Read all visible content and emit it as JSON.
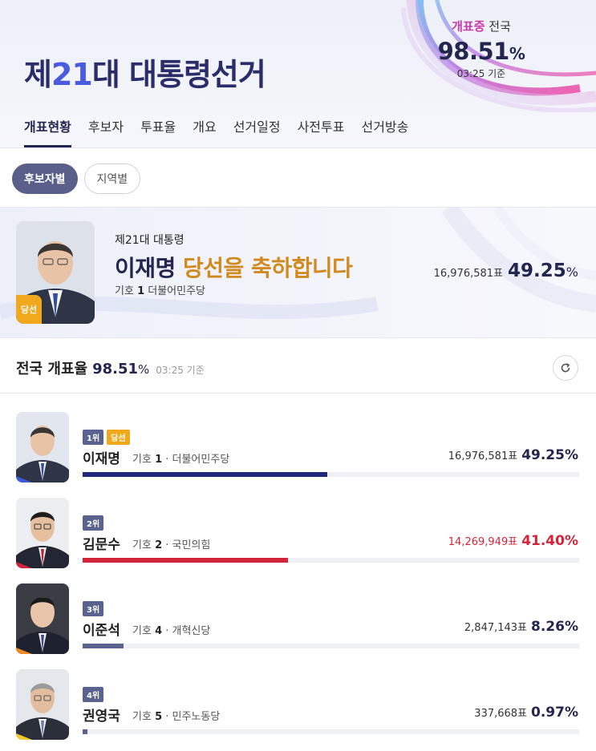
{
  "header": {
    "title_prefix": "제",
    "title_number": "21",
    "title_suffix": "대 대통령선거",
    "status_highlight": "개표중",
    "status_region": "전국",
    "status_percent": "98.51",
    "status_percent_unit": "%",
    "status_time": "03:25 기준"
  },
  "tabs": [
    {
      "label": "개표현황",
      "active": true
    },
    {
      "label": "후보자"
    },
    {
      "label": "투표율"
    },
    {
      "label": "개요"
    },
    {
      "label": "선거일정"
    },
    {
      "label": "사전투표"
    },
    {
      "label": "선거방송"
    }
  ],
  "filters": {
    "by_candidate": "후보자별",
    "by_region": "지역별"
  },
  "winner": {
    "subtitle": "제21대 대통령",
    "name": "이재명",
    "congrats": "당선을 축하합니다",
    "symbol_label": "기호",
    "symbol_no": "1",
    "party": "더불어민주당",
    "votes": "16,976,581표",
    "percent": "49.25",
    "percent_unit": "%",
    "badge": "당선"
  },
  "summary": {
    "label": "전국 개표율",
    "percent": "98.51",
    "unit": "%",
    "time": "03:25 기준"
  },
  "candidates": [
    {
      "rank": "1위",
      "won": "당선",
      "name": "이재명",
      "symbol_label": "기호",
      "symbol_no": "1",
      "party": "· 더불어민주당",
      "votes": "16,976,581표",
      "percent": "49.25%",
      "share": 49.25,
      "color": "#23297a"
    },
    {
      "rank": "2위",
      "name": "김문수",
      "symbol_label": "기호",
      "symbol_no": "2",
      "party": "· 국민의힘",
      "votes": "14,269,949표",
      "percent": "41.40%",
      "share": 41.4,
      "color": "#d3253a"
    },
    {
      "rank": "3위",
      "name": "이준석",
      "symbol_label": "기호",
      "symbol_no": "4",
      "party": "· 개혁신당",
      "votes": "2,847,143표",
      "percent": "8.26%",
      "share": 8.26,
      "color": "#5a6290"
    },
    {
      "rank": "4위",
      "name": "권영국",
      "symbol_label": "기호",
      "symbol_no": "5",
      "party": "· 민주노동당",
      "votes": "337,668표",
      "percent": "0.97%",
      "share": 0.97,
      "color": "#5a6290"
    }
  ],
  "colors": {
    "navy": "#23264f",
    "accent_gold": "#d08a1f",
    "red": "#d3253a",
    "pill_active": "#5a5f8a"
  }
}
